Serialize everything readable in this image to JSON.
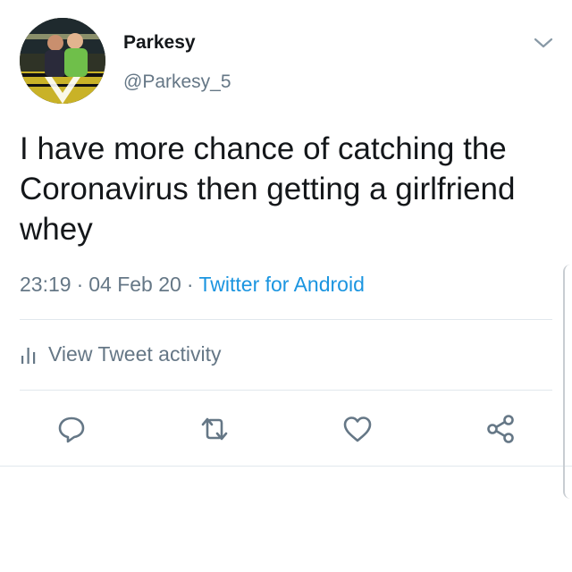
{
  "tweet": {
    "display_name": "Parkesy",
    "handle": "@Parkesy_5",
    "text": "I have more chance of catching the Coronavirus then getting a girlfriend whey",
    "time": "23:19",
    "date": "04 Feb 20",
    "source": "Twitter for Android"
  },
  "activity": {
    "label": "View Tweet activity",
    "icon": "bar-chart-icon"
  },
  "actions": {
    "reply_icon": "reply-icon",
    "retweet_icon": "retweet-icon",
    "like_icon": "heart-icon",
    "share_icon": "share-icon"
  },
  "colors": {
    "text": "#14171a",
    "secondary": "#657786",
    "link": "#1b95e0",
    "divider": "#e1e8ed"
  }
}
